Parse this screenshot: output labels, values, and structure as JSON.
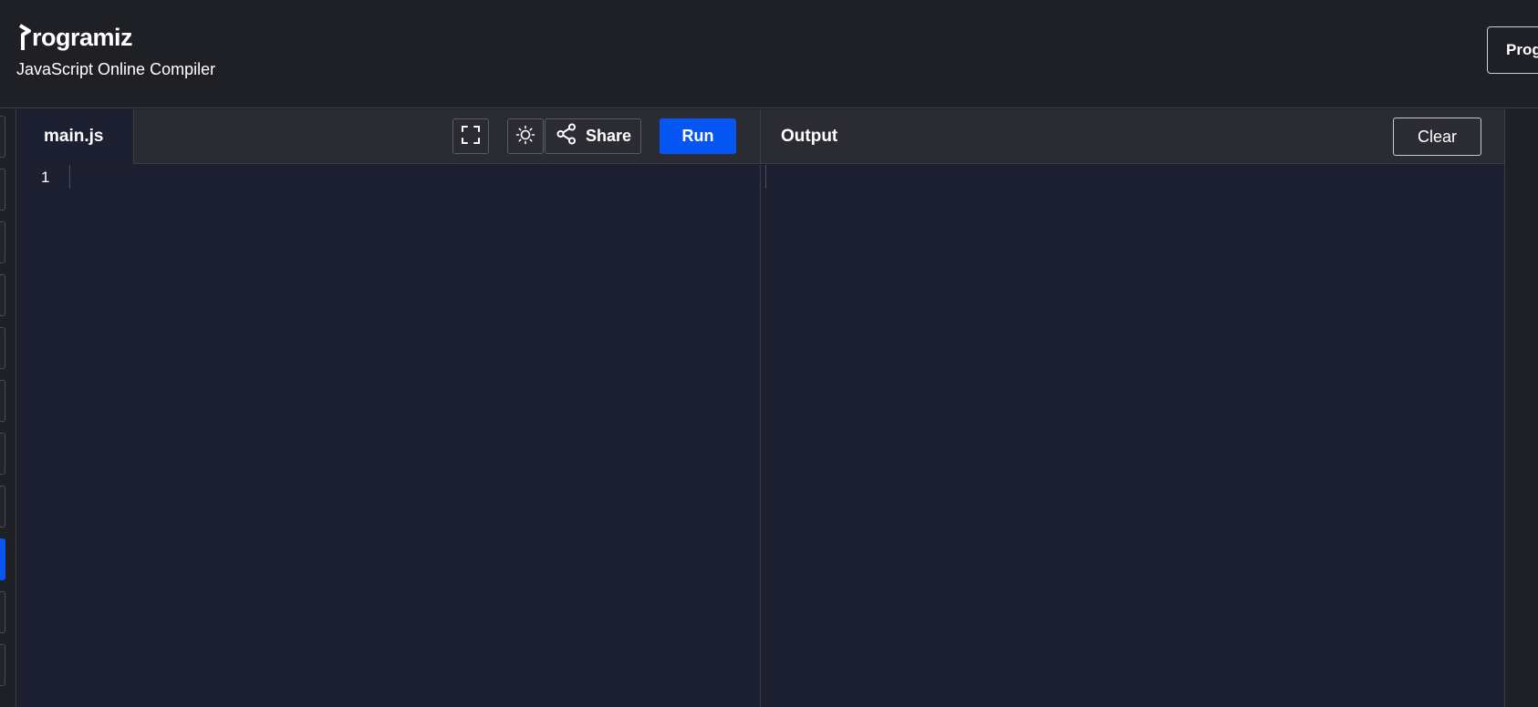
{
  "header": {
    "logo_text": "rogramiz",
    "subtitle": "JavaScript Online Compiler",
    "cta_label": "Prog"
  },
  "rail": {
    "active_index": 8
  },
  "editor": {
    "file_tab": "main.js",
    "fullscreen_icon": "fullscreen-icon",
    "theme_icon": "sun-icon",
    "share_label": "Share",
    "share_icon": "share-icon",
    "run_label": "Run",
    "line_numbers": [
      "1"
    ],
    "code": ""
  },
  "output": {
    "title": "Output",
    "clear_label": "Clear",
    "content": ""
  },
  "colors": {
    "accent": "#0556f3",
    "header_bg": "#1f2026",
    "editor_bg": "#1c2030",
    "toolbar_bg": "#2b2c33"
  }
}
